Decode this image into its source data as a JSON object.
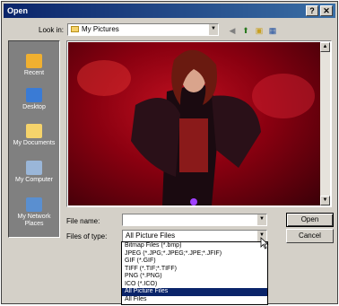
{
  "window": {
    "title": "Open",
    "help_button": "?",
    "close_button": "✕"
  },
  "look_in": {
    "label": "Look in:",
    "value": "My Pictures",
    "toolbar_icons": [
      "back-icon",
      "up-folder-icon",
      "new-folder-icon",
      "views-icon"
    ]
  },
  "places": [
    {
      "label": "Recent",
      "icon": "recent-icon",
      "color": "#f0b030"
    },
    {
      "label": "Desktop",
      "icon": "desktop-icon",
      "color": "#3a7bd5"
    },
    {
      "label": "My Documents",
      "icon": "my-documents-icon",
      "color": "#f5d36b"
    },
    {
      "label": "My Computer",
      "icon": "my-computer-icon",
      "color": "#9ab6d8"
    },
    {
      "label": "My Network Places",
      "icon": "network-places-icon",
      "color": "#5a8fd0"
    }
  ],
  "file_name": {
    "label": "File name:",
    "value": ""
  },
  "files_of_type": {
    "label": "Files of type:",
    "value": "All Picture Files",
    "options": [
      "Bitmap Files (*.bmp)",
      "JPEG (*.JPG;*.JPEG;*.JPE;*.JFIF)",
      "GIF (*.GIF)",
      "TIFF (*.TIF;*.TIFF)",
      "PNG (*.PNG)",
      "ICO (*.ICO)",
      "All Picture Files",
      "All Files"
    ],
    "selected_index": 6
  },
  "buttons": {
    "open": "Open",
    "cancel": "Cancel"
  },
  "colors": {
    "title_bar": "#0a246a",
    "selection": "#0a246a",
    "dialog_face": "#d4d0c8"
  }
}
